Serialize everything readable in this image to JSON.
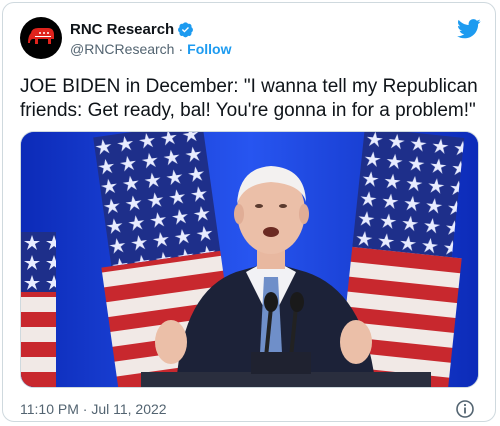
{
  "author": {
    "display_name": "RNC Research",
    "handle": "@RNCResearch",
    "separator": "·",
    "follow_label": "Follow"
  },
  "tweet": {
    "text": "JOE BIDEN in December: \"I wanna tell my Republican friends: Get ready, bal! You're gonna in for a problem!\""
  },
  "footer": {
    "timestamp": "11:10 PM · Jul 11, 2022"
  },
  "colors": {
    "accent": "#1d9bf0",
    "secondary_text": "#536471",
    "border": "#cfd9de",
    "logo_red": "#e0231c"
  },
  "icons": {
    "verified": "verified-badge-icon",
    "brand": "twitter-bird-icon",
    "info": "info-circle-icon",
    "avatar": "republican-elephant-logo"
  }
}
